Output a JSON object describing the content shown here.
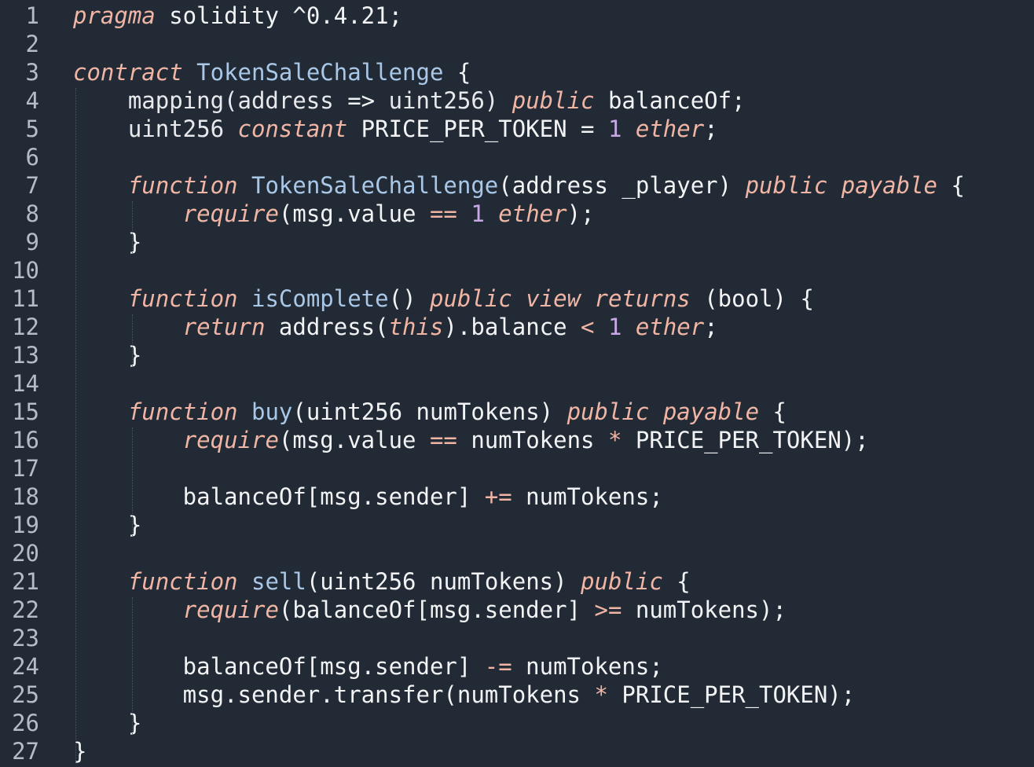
{
  "editor": {
    "language": "solidity",
    "colors": {
      "background": "#222a35",
      "line_number": "#b6bcc5",
      "text": "#f2f3f5",
      "keyword": "#f0b5a5",
      "function_name": "#a9c8e8",
      "number": "#c9a8e8"
    },
    "lines": [
      {
        "n": "1",
        "tokens": [
          {
            "t": "pragma",
            "c": "kw"
          },
          {
            "t": " solidity ^0.4.21;",
            "c": "var"
          }
        ]
      },
      {
        "n": "2",
        "tokens": []
      },
      {
        "n": "3",
        "tokens": [
          {
            "t": "contract",
            "c": "kw"
          },
          {
            "t": " ",
            "c": "pun"
          },
          {
            "t": "TokenSaleChallenge",
            "c": "fn"
          },
          {
            "t": " {",
            "c": "pun"
          }
        ]
      },
      {
        "n": "4",
        "tokens": [
          {
            "t": "    mapping(address ",
            "c": "type"
          },
          {
            "t": "=>",
            "c": "var"
          },
          {
            "t": " uint256) ",
            "c": "type"
          },
          {
            "t": "public",
            "c": "kw"
          },
          {
            "t": " balanceOf;",
            "c": "var"
          }
        ]
      },
      {
        "n": "5",
        "tokens": [
          {
            "t": "    uint256 ",
            "c": "type"
          },
          {
            "t": "constant",
            "c": "kw"
          },
          {
            "t": " PRICE_PER_TOKEN = ",
            "c": "var"
          },
          {
            "t": "1",
            "c": "num"
          },
          {
            "t": " ",
            "c": "pun"
          },
          {
            "t": "ether",
            "c": "kw"
          },
          {
            "t": ";",
            "c": "pun"
          }
        ]
      },
      {
        "n": "6",
        "tokens": []
      },
      {
        "n": "7",
        "tokens": [
          {
            "t": "    ",
            "c": "pun"
          },
          {
            "t": "function",
            "c": "kw"
          },
          {
            "t": " ",
            "c": "pun"
          },
          {
            "t": "TokenSaleChallenge",
            "c": "fn"
          },
          {
            "t": "(address _player) ",
            "c": "var"
          },
          {
            "t": "public",
            "c": "kw"
          },
          {
            "t": " ",
            "c": "pun"
          },
          {
            "t": "payable",
            "c": "kw"
          },
          {
            "t": " {",
            "c": "pun"
          }
        ]
      },
      {
        "n": "8",
        "tokens": [
          {
            "t": "        ",
            "c": "pun"
          },
          {
            "t": "require",
            "c": "kw"
          },
          {
            "t": "(msg.value ",
            "c": "var"
          },
          {
            "t": "==",
            "c": "op"
          },
          {
            "t": " ",
            "c": "pun"
          },
          {
            "t": "1",
            "c": "num"
          },
          {
            "t": " ",
            "c": "pun"
          },
          {
            "t": "ether",
            "c": "kw"
          },
          {
            "t": ");",
            "c": "pun"
          }
        ]
      },
      {
        "n": "9",
        "tokens": [
          {
            "t": "    }",
            "c": "pun"
          }
        ]
      },
      {
        "n": "10",
        "tokens": []
      },
      {
        "n": "11",
        "tokens": [
          {
            "t": "    ",
            "c": "pun"
          },
          {
            "t": "function",
            "c": "kw"
          },
          {
            "t": " ",
            "c": "pun"
          },
          {
            "t": "isComplete",
            "c": "fn"
          },
          {
            "t": "() ",
            "c": "var"
          },
          {
            "t": "public",
            "c": "kw"
          },
          {
            "t": " ",
            "c": "pun"
          },
          {
            "t": "view",
            "c": "kw"
          },
          {
            "t": " ",
            "c": "pun"
          },
          {
            "t": "returns",
            "c": "kw"
          },
          {
            "t": " (bool) {",
            "c": "var"
          }
        ]
      },
      {
        "n": "12",
        "tokens": [
          {
            "t": "        ",
            "c": "pun"
          },
          {
            "t": "return",
            "c": "kw"
          },
          {
            "t": " address(",
            "c": "var"
          },
          {
            "t": "this",
            "c": "kw"
          },
          {
            "t": ").balance ",
            "c": "var"
          },
          {
            "t": "<",
            "c": "op"
          },
          {
            "t": " ",
            "c": "pun"
          },
          {
            "t": "1",
            "c": "num"
          },
          {
            "t": " ",
            "c": "pun"
          },
          {
            "t": "ether",
            "c": "kw"
          },
          {
            "t": ";",
            "c": "pun"
          }
        ]
      },
      {
        "n": "13",
        "tokens": [
          {
            "t": "    }",
            "c": "pun"
          }
        ]
      },
      {
        "n": "14",
        "tokens": []
      },
      {
        "n": "15",
        "tokens": [
          {
            "t": "    ",
            "c": "pun"
          },
          {
            "t": "function",
            "c": "kw"
          },
          {
            "t": " ",
            "c": "pun"
          },
          {
            "t": "buy",
            "c": "fn"
          },
          {
            "t": "(uint256 numTokens) ",
            "c": "var"
          },
          {
            "t": "public",
            "c": "kw"
          },
          {
            "t": " ",
            "c": "pun"
          },
          {
            "t": "payable",
            "c": "kw"
          },
          {
            "t": " {",
            "c": "pun"
          }
        ]
      },
      {
        "n": "16",
        "tokens": [
          {
            "t": "        ",
            "c": "pun"
          },
          {
            "t": "require",
            "c": "kw"
          },
          {
            "t": "(msg.value ",
            "c": "var"
          },
          {
            "t": "==",
            "c": "op"
          },
          {
            "t": " numTokens ",
            "c": "var"
          },
          {
            "t": "*",
            "c": "op"
          },
          {
            "t": " PRICE_PER_TOKEN);",
            "c": "var"
          }
        ]
      },
      {
        "n": "17",
        "tokens": []
      },
      {
        "n": "18",
        "tokens": [
          {
            "t": "        balanceOf[msg.sender] ",
            "c": "var"
          },
          {
            "t": "+=",
            "c": "op"
          },
          {
            "t": " numTokens;",
            "c": "var"
          }
        ]
      },
      {
        "n": "19",
        "tokens": [
          {
            "t": "    }",
            "c": "pun"
          }
        ]
      },
      {
        "n": "20",
        "tokens": []
      },
      {
        "n": "21",
        "tokens": [
          {
            "t": "    ",
            "c": "pun"
          },
          {
            "t": "function",
            "c": "kw"
          },
          {
            "t": " ",
            "c": "pun"
          },
          {
            "t": "sell",
            "c": "fn"
          },
          {
            "t": "(uint256 numTokens) ",
            "c": "var"
          },
          {
            "t": "public",
            "c": "kw"
          },
          {
            "t": " {",
            "c": "pun"
          }
        ]
      },
      {
        "n": "22",
        "tokens": [
          {
            "t": "        ",
            "c": "pun"
          },
          {
            "t": "require",
            "c": "kw"
          },
          {
            "t": "(balanceOf[msg.sender] ",
            "c": "var"
          },
          {
            "t": ">=",
            "c": "op"
          },
          {
            "t": " numTokens);",
            "c": "var"
          }
        ]
      },
      {
        "n": "23",
        "tokens": []
      },
      {
        "n": "24",
        "tokens": [
          {
            "t": "        balanceOf[msg.sender] ",
            "c": "var"
          },
          {
            "t": "-=",
            "c": "op"
          },
          {
            "t": " numTokens;",
            "c": "var"
          }
        ]
      },
      {
        "n": "25",
        "tokens": [
          {
            "t": "        msg.sender.transfer(numTokens ",
            "c": "var"
          },
          {
            "t": "*",
            "c": "op"
          },
          {
            "t": " PRICE_PER_TOKEN);",
            "c": "var"
          }
        ]
      },
      {
        "n": "26",
        "tokens": [
          {
            "t": "    }",
            "c": "pun"
          }
        ]
      },
      {
        "n": "27",
        "tokens": [
          {
            "t": "}",
            "c": "pun"
          }
        ]
      }
    ]
  }
}
